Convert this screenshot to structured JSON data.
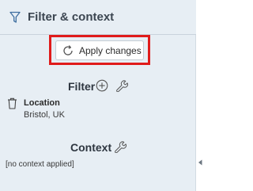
{
  "header": {
    "title": "Filter & context",
    "icon": "filter-icon"
  },
  "apply_button": {
    "label": "Apply changes",
    "icon": "refresh-icon",
    "highlight_color": "#e01b1b"
  },
  "filter_section": {
    "title": "Filter",
    "add_icon": "plus-circle-icon",
    "settings_icon": "wrench-icon",
    "items": [
      {
        "label": "Location",
        "value": "Bristol, UK",
        "remove_icon": "trash-icon"
      }
    ]
  },
  "context_section": {
    "title": "Context",
    "settings_icon": "wrench-icon",
    "empty_text": "[no context applied]"
  },
  "colors": {
    "panel_bg": "#e7eef4",
    "accent": "#3c4651",
    "highlight": "#e01b1b"
  }
}
